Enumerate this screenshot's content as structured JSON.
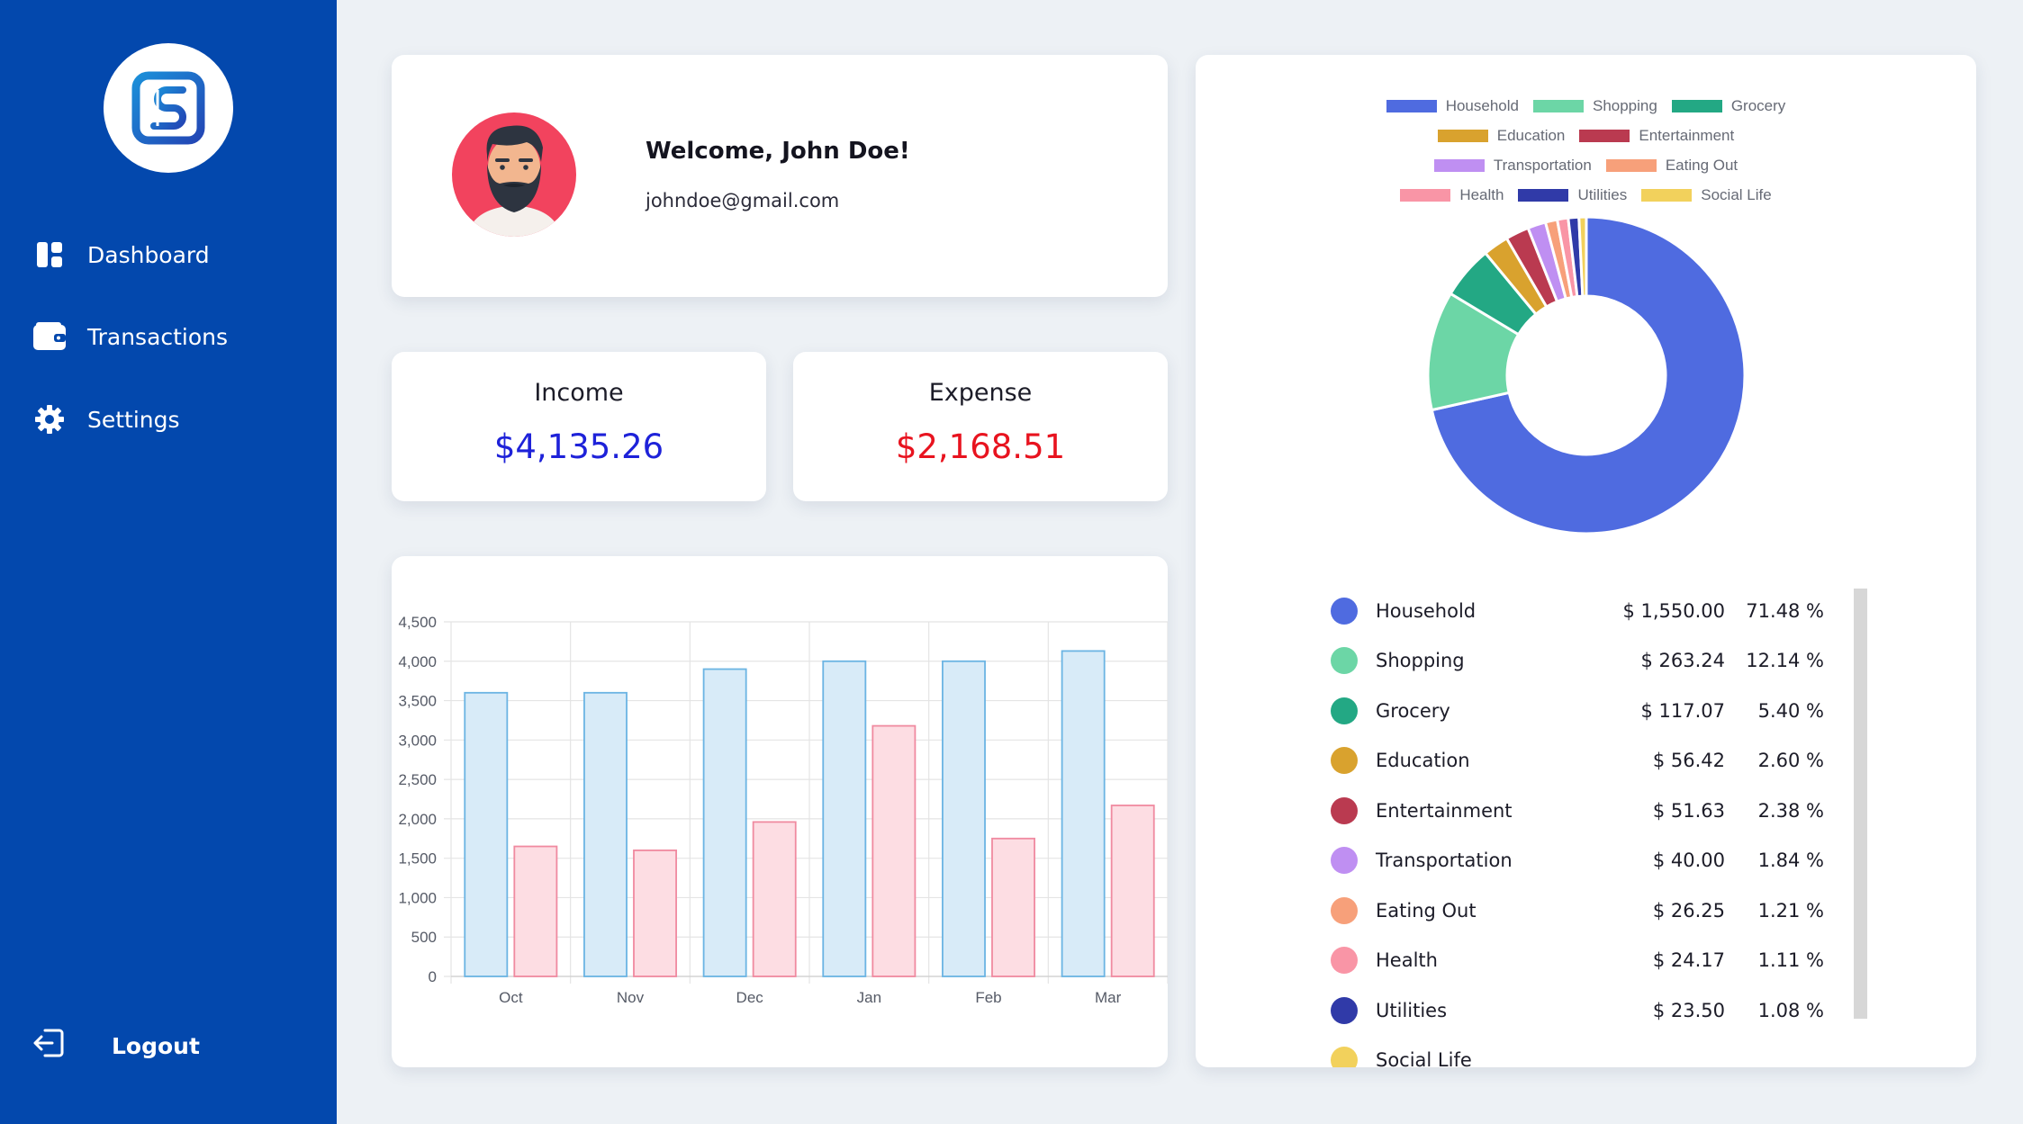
{
  "sidebar": {
    "logo_icon": "app-logo-icon",
    "items": [
      {
        "label": "Dashboard",
        "icon": "dashboard-icon"
      },
      {
        "label": "Transactions",
        "icon": "wallet-icon"
      },
      {
        "label": "Settings",
        "icon": "gear-icon"
      }
    ],
    "logout": {
      "label": "Logout",
      "icon": "logout-icon"
    }
  },
  "profile": {
    "welcome": "Welcome, John Doe!",
    "email": "johndoe@gmail.com",
    "avatar": "avatar-icon"
  },
  "stats": {
    "income": {
      "title": "Income",
      "value": "$4,135.26",
      "color": "#1e22d9"
    },
    "expense": {
      "title": "Expense",
      "value": "$2,168.51",
      "color": "#e8131f"
    }
  },
  "chart_data": [
    {
      "type": "bar",
      "categories": [
        "Oct",
        "Nov",
        "Dec",
        "Jan",
        "Feb",
        "Mar"
      ],
      "series": [
        {
          "values": [
            3600,
            3600,
            3900,
            4000,
            4000,
            4130
          ],
          "fill": "#d8ebf8",
          "stroke": "#6bb4e3"
        },
        {
          "values": [
            1650,
            1600,
            1960,
            3180,
            1750,
            2170
          ],
          "fill": "#fddde3",
          "stroke": "#f08aa0"
        }
      ],
      "ylim": [
        0,
        4500
      ],
      "yticks": [
        "0",
        "500",
        "1,000",
        "1,500",
        "2,000",
        "2,500",
        "3,000",
        "3,500",
        "4,000",
        "4,500"
      ],
      "grid": true
    },
    {
      "type": "pie",
      "legend_position": "top",
      "slices": [
        {
          "label": "Household",
          "value": 1550.0,
          "amount": "$ 1,550.00",
          "percent": "71.48 %",
          "color": "#4f6be0"
        },
        {
          "label": "Shopping",
          "value": 263.24,
          "amount": "$ 263.24",
          "percent": "12.14 %",
          "color": "#6cd6a6"
        },
        {
          "label": "Grocery",
          "value": 117.07,
          "amount": "$ 117.07",
          "percent": "5.40 %",
          "color": "#23a884"
        },
        {
          "label": "Education",
          "value": 56.42,
          "amount": "$ 56.42",
          "percent": "2.60 %",
          "color": "#d9a22e"
        },
        {
          "label": "Entertainment",
          "value": 51.63,
          "amount": "$ 51.63",
          "percent": "2.38 %",
          "color": "#ba3a50"
        },
        {
          "label": "Transportation",
          "value": 40.0,
          "amount": "$ 40.00",
          "percent": "1.84 %",
          "color": "#bf8ff2"
        },
        {
          "label": "Eating Out",
          "value": 26.25,
          "amount": "$ 26.25",
          "percent": "1.21 %",
          "color": "#f7a07a"
        },
        {
          "label": "Health",
          "value": 24.17,
          "amount": "$ 24.17",
          "percent": "1.11 %",
          "color": "#f995a6"
        },
        {
          "label": "Utilities",
          "value": 23.5,
          "amount": "$ 23.50",
          "percent": "1.08 %",
          "color": "#303aa8"
        },
        {
          "label": "Social Life",
          "value": 16.23,
          "color": "#f2d15c"
        }
      ]
    }
  ]
}
